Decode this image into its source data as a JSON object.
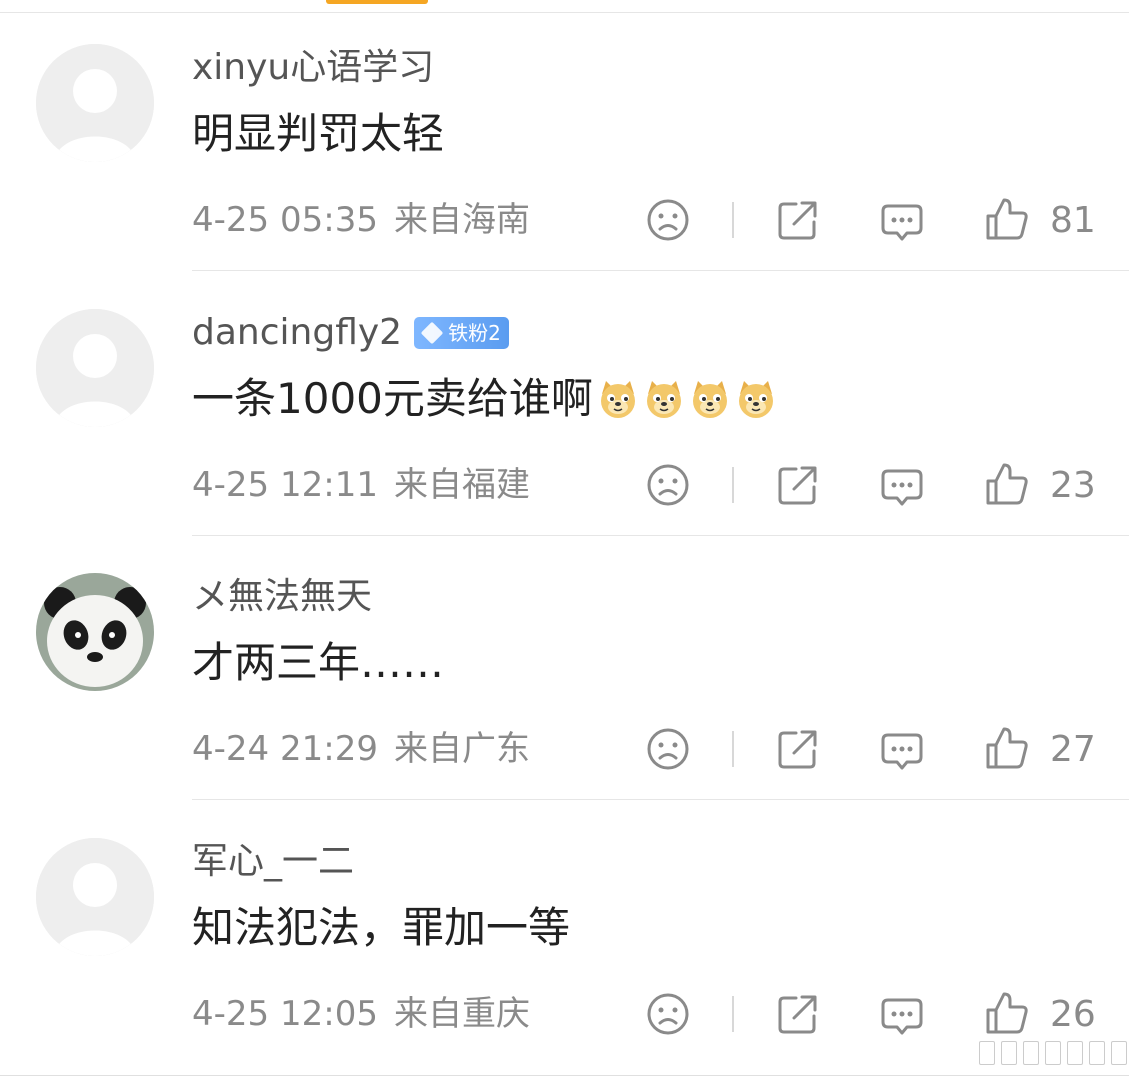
{
  "colors": {
    "accent": "#f5a623",
    "badge": "#5a9cf0",
    "meta": "#8a8a8a",
    "text": "#222222"
  },
  "comments": [
    {
      "username": "xinyu心语学习",
      "badge": "",
      "content": "明显判罚太轻",
      "emoji": [],
      "time": "4-25 05:35",
      "location": "来自海南",
      "likes": "81",
      "avatar": "default-avatar"
    },
    {
      "username": "dancingfly2",
      "badge": "铁粉2",
      "content": "一条1000元卖给谁啊",
      "emoji": [
        "doge",
        "doge",
        "doge",
        "doge"
      ],
      "time": "4-25 12:11",
      "location": "来自福建",
      "likes": "23",
      "avatar": "default-avatar"
    },
    {
      "username": "メ無法無天",
      "badge": "",
      "content": "才两三年……",
      "emoji": [],
      "time": "4-24 21:29",
      "location": "来自广东",
      "likes": "27",
      "avatar": "panda-avatar"
    },
    {
      "username": "军心_一二",
      "badge": "",
      "content": "知法犯法，罪加一等",
      "emoji": [],
      "time": "4-25 12:05",
      "location": "来自重庆",
      "likes": "26",
      "avatar": "default-avatar"
    }
  ],
  "icons": {
    "dislike": "frown-face-icon",
    "share": "share-arrow-icon",
    "reply": "comment-bubble-icon",
    "like": "thumbs-up-icon"
  }
}
